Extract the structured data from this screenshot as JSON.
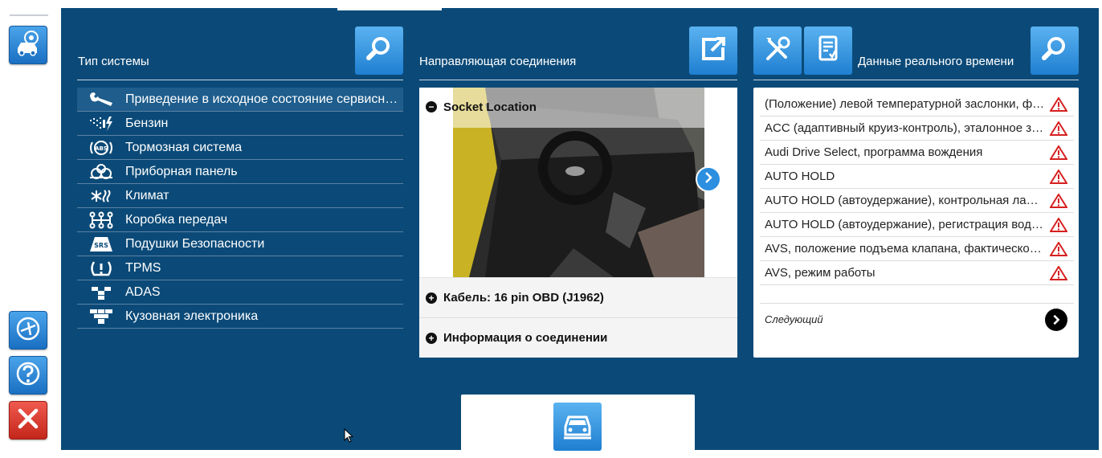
{
  "colors": {
    "panel": "#0b4a78",
    "accent_blue": "#1f7fd1",
    "warning": "#d62020",
    "close_red": "#c4261b"
  },
  "left_toolbar": {
    "top_button_icon": "car-service-icon",
    "bottom_buttons": [
      {
        "icon": "no-flight-icon"
      },
      {
        "icon": "help-icon"
      },
      {
        "icon": "close-icon"
      }
    ]
  },
  "system_section": {
    "title": "Тип системы",
    "search_icon": "search-icon",
    "items": [
      {
        "icon": "wrench-icon",
        "label": "Приведение в исходное состояние сервисного интервала"
      },
      {
        "icon": "fuel-injection-icon",
        "label": "Бензин"
      },
      {
        "icon": "abs-icon",
        "label": "Тормозная система"
      },
      {
        "icon": "dashboard-icon",
        "label": "Приборная панель"
      },
      {
        "icon": "climate-icon",
        "label": "Климат"
      },
      {
        "icon": "gearbox-icon",
        "label": "Коробка передач"
      },
      {
        "icon": "srs-icon",
        "label": "Подушки Безопасности"
      },
      {
        "icon": "tpms-icon",
        "label": "TPMS"
      },
      {
        "icon": "adas-icon",
        "label": "ADAS"
      },
      {
        "icon": "body-electronics-icon",
        "label": "Кузовная электроника"
      }
    ]
  },
  "connection_section": {
    "title": "Направляющая соединения",
    "export_icon": "external-link-icon",
    "socket_label": "Socket Location",
    "cable_label": "Кабель: 16 pin OBD (J1962)",
    "info_label": "Информация о соединении"
  },
  "live_section": {
    "title": "Данные реального времени",
    "tool_icons": [
      "tools-icon",
      "data-sheet-icon"
    ],
    "search_icon": "search-icon",
    "rows": [
      "(Положение) левой температурной заслонки, фактическое значение",
      "ACC (адаптивный круиз-контроль), эталонное значение",
      "Audi Drive Select, программа вождения",
      "AUTO HOLD",
      "AUTO HOLD (автоудержание), контрольная лампа",
      "AUTO HOLD (автоудержание), регистрация водителя",
      "AVS, положение подъема клапана, фактическое значение",
      "AVS, режим работы"
    ],
    "next_label": "Следующий"
  },
  "bottom_tab": {
    "icon": "vehicle-front-icon"
  }
}
